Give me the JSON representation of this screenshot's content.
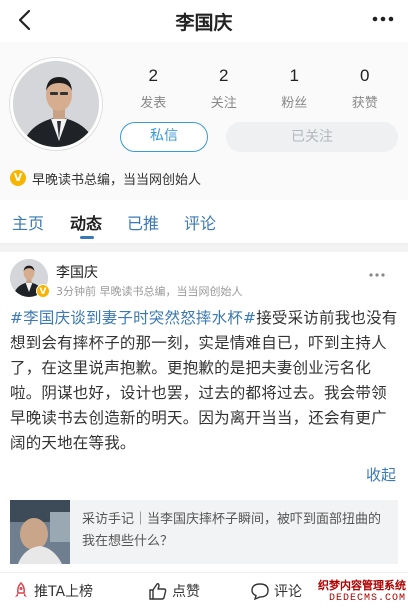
{
  "nav": {
    "title": "李国庆"
  },
  "profile": {
    "stats": [
      {
        "value": "2",
        "label": "发表"
      },
      {
        "value": "2",
        "label": "关注"
      },
      {
        "value": "1",
        "label": "粉丝"
      },
      {
        "value": "0",
        "label": "获赞"
      }
    ],
    "message_button": "私信",
    "follow_button": "已关注",
    "bio": "早晚读书总编，当当网创始人"
  },
  "tabs": [
    {
      "label": "主页",
      "active": false
    },
    {
      "label": "动态",
      "active": true
    },
    {
      "label": "已推",
      "active": false
    },
    {
      "label": "评论",
      "active": false
    }
  ],
  "post": {
    "author": "李国庆",
    "meta": "3分钟前  早晚读书总编，当当网创始人",
    "topic": "#李国庆谈到妻子时突然怒摔水杯#",
    "body": "接受采访前我也没有想到会有摔杯子的那一刻，实是情难自已，吓到主持人了，在这里说声抱歉。更抱歉的是把夫妻创业污名化啦。阴谋也好，设计也罢，过去的都将过去。我会带领早晚读书去创造新的明天。因为离开当当，还会有更广阔的天地在等我。",
    "collapse_label": "收起",
    "card_text": "采访手记｜当李国庆摔杯子瞬间，被吓到面部扭曲的我在想些什么？"
  },
  "actions": {
    "push_label": "推TA上榜",
    "like_label": "点赞",
    "comment_label": "评论"
  },
  "watermark": {
    "line1": "织梦内容管理系统",
    "line2": "DEDECMS.COM"
  },
  "colors": {
    "link_blue": "#3a79b5",
    "button_blue": "#3a9ad9",
    "verified_gold": "#f7b500"
  }
}
